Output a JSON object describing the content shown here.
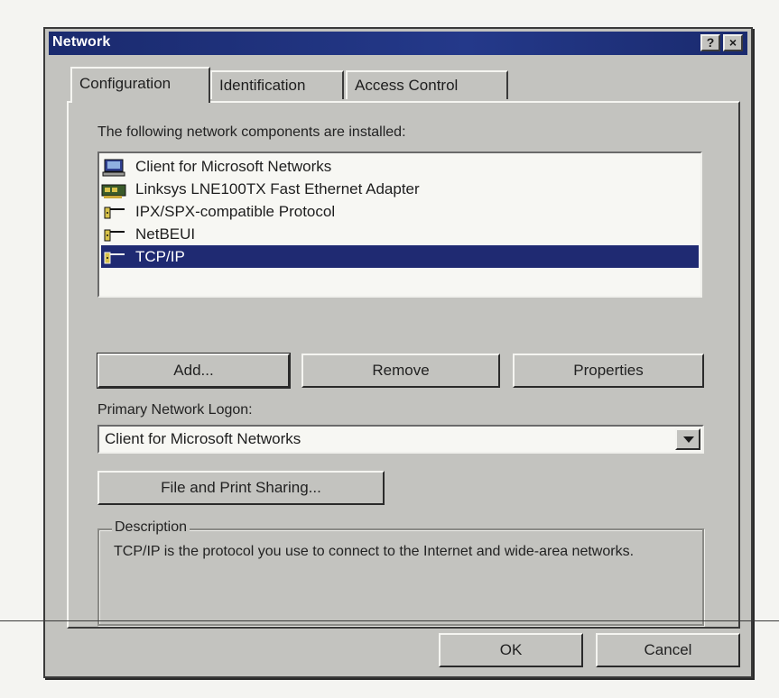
{
  "window": {
    "title": "Network",
    "help_button": "?",
    "close_button": "×"
  },
  "tabs": [
    {
      "label": "Configuration",
      "active": true
    },
    {
      "label": "Identification",
      "active": false
    },
    {
      "label": "Access Control",
      "active": false
    }
  ],
  "components": {
    "label": "The following network components are installed:",
    "items": [
      {
        "label": "Client for Microsoft Networks",
        "icon": "client-icon",
        "selected": false
      },
      {
        "label": "Linksys LNE100TX Fast Ethernet Adapter",
        "icon": "network-adapter-icon",
        "selected": false
      },
      {
        "label": "IPX/SPX-compatible Protocol",
        "icon": "protocol-icon",
        "selected": false
      },
      {
        "label": "NetBEUI",
        "icon": "protocol-icon",
        "selected": false
      },
      {
        "label": "TCP/IP",
        "icon": "protocol-icon",
        "selected": true
      }
    ]
  },
  "buttons": {
    "add": "Add...",
    "remove": "Remove",
    "properties": "Properties",
    "file_print_sharing": "File and Print Sharing...",
    "ok": "OK",
    "cancel": "Cancel"
  },
  "primary_logon": {
    "label": "Primary Network Logon:",
    "value": "Client for Microsoft Networks"
  },
  "description": {
    "title": "Description",
    "text": "TCP/IP is the protocol you use to connect to the Internet and wide-area networks."
  },
  "colors": {
    "titlebar": "#1a2a6e",
    "selection": "#1f2a72",
    "dialog_face": "#c3c3bf"
  }
}
